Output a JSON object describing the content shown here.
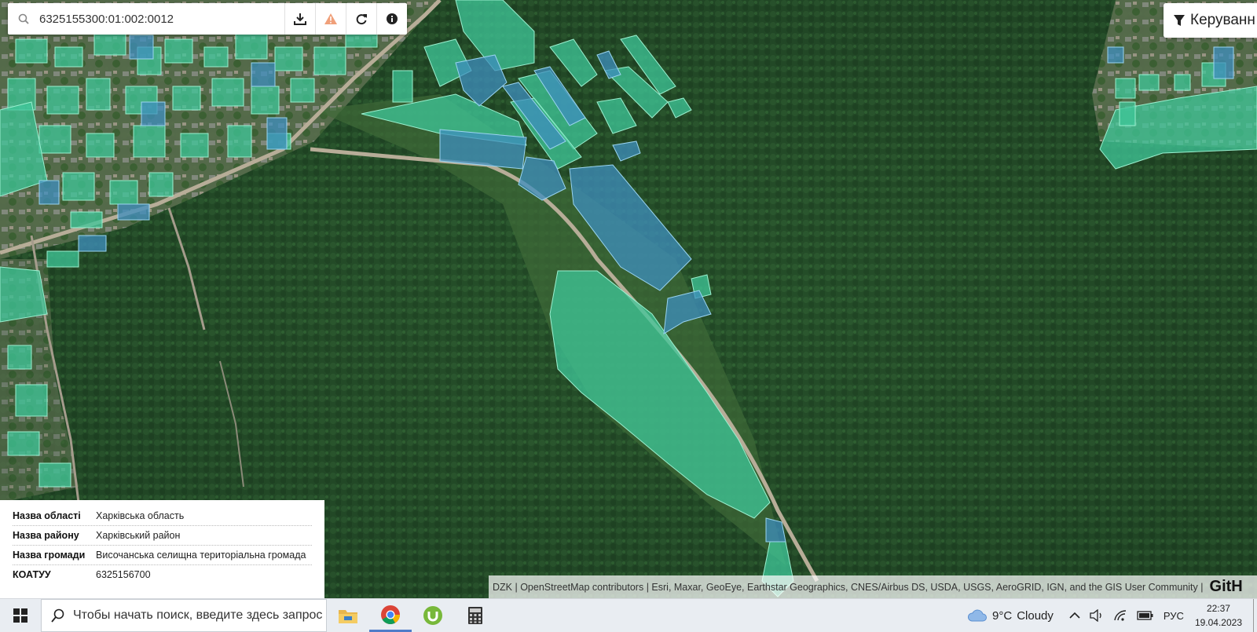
{
  "search": {
    "query": "6325155300:01:002:0012"
  },
  "toolbar_icons": [
    "download-icon",
    "warning-icon",
    "refresh-icon",
    "info-icon"
  ],
  "manage_button": {
    "label": "Керуванн"
  },
  "info_panel": {
    "rows": [
      {
        "key": "Назва області",
        "value": "Харківська область"
      },
      {
        "key": "Назва району",
        "value": "Харківський район"
      },
      {
        "key": "Назва громади",
        "value": "Височанська селищна територіальна громада"
      },
      {
        "key": "КОАТУУ",
        "value": "6325156700"
      }
    ]
  },
  "attribution": {
    "text": "DZK | OpenStreetMap contributors | Esri, Maxar, GeoEye, Earthstar Geographics, CNES/Airbus DS, USDA, USGS, AeroGRID, IGN, and the GIS User Community |",
    "github": "GitH"
  },
  "taskbar": {
    "search_placeholder": "Чтобы начать поиск, введите здесь запрос",
    "apps": [
      "file-explorer-icon",
      "chrome-icon",
      "utorrent-icon",
      "calculator-icon"
    ],
    "weather": {
      "temp": "9°C",
      "condition": "Cloudy"
    },
    "language": "РУС",
    "time": "22:37",
    "date": "19.04.2023"
  },
  "colors": {
    "parcel_green": "#3fc79a",
    "parcel_blue": "#3f8fbf",
    "forest": "#1f4526"
  }
}
